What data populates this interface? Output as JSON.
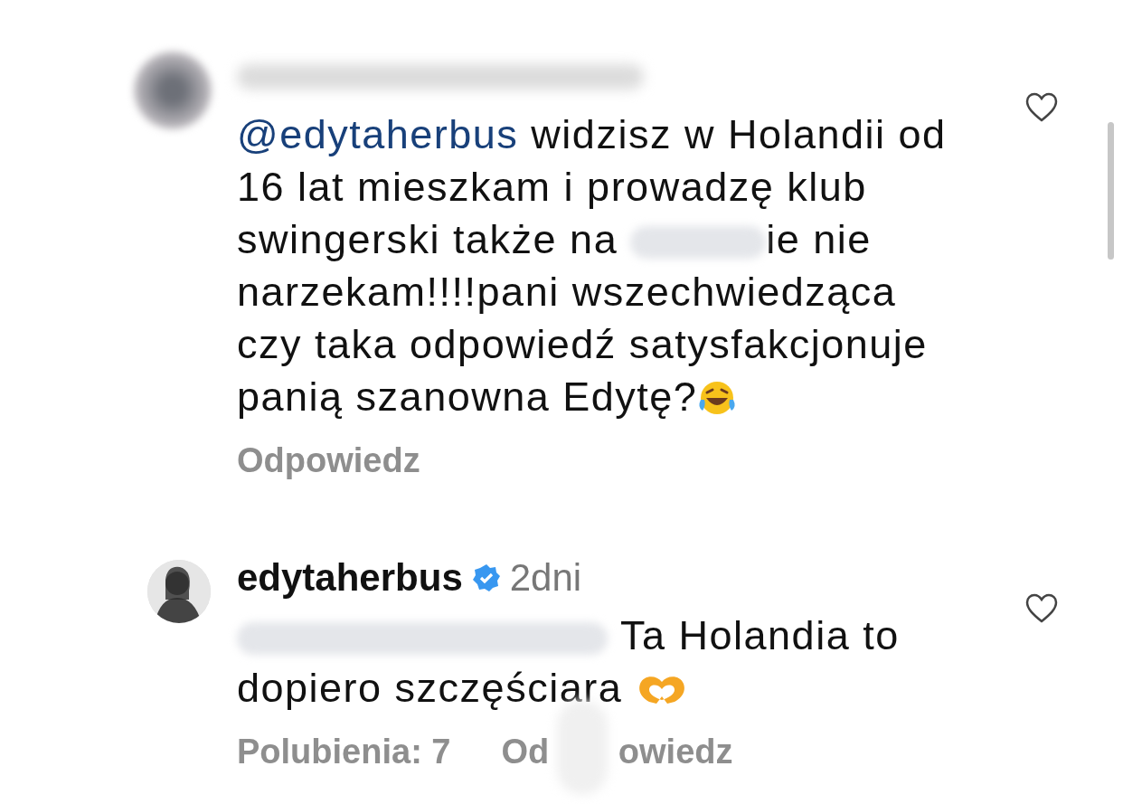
{
  "comments": [
    {
      "avatar": {
        "kind": "blurred"
      },
      "liked": false,
      "lines": [
        [
          {
            "kind": "mention",
            "text": "@edytaherbus"
          },
          {
            "kind": "text",
            "text": " widzisz w Holandii od"
          }
        ],
        [
          {
            "kind": "text",
            "text": "16 lat mieszkam i prowadzę klub"
          }
        ],
        [
          {
            "kind": "text",
            "text": "swingerski także na "
          },
          {
            "kind": "blur"
          },
          {
            "kind": "text",
            "text": "ie nie"
          }
        ],
        [
          {
            "kind": "text",
            "text": "narzekam!!!!pani wszechwiedząca"
          }
        ],
        [
          {
            "kind": "text",
            "text": "czy taka odpowiedź satysfakcjonuje"
          }
        ],
        [
          {
            "kind": "text",
            "text": "panią szanowna Edytę?"
          },
          {
            "kind": "laughing"
          }
        ]
      ],
      "reply_parts": [
        "Odpowiedz"
      ]
    },
    {
      "avatar": {
        "kind": "photo"
      },
      "author": "edytaherbus",
      "verified": true,
      "time": "2dni",
      "liked": false,
      "lines": [
        [
          {
            "kind": "blur"
          },
          {
            "kind": "text",
            "text": "Ta Holandia to"
          }
        ],
        [
          {
            "kind": "text",
            "text": "dopiero szczęściara "
          },
          {
            "kind": "hearthands"
          }
        ]
      ],
      "likes": "Polubienia: 7",
      "reply_parts": [
        "Od",
        "owiedz"
      ],
      "overlay_blur": true
    }
  ]
}
